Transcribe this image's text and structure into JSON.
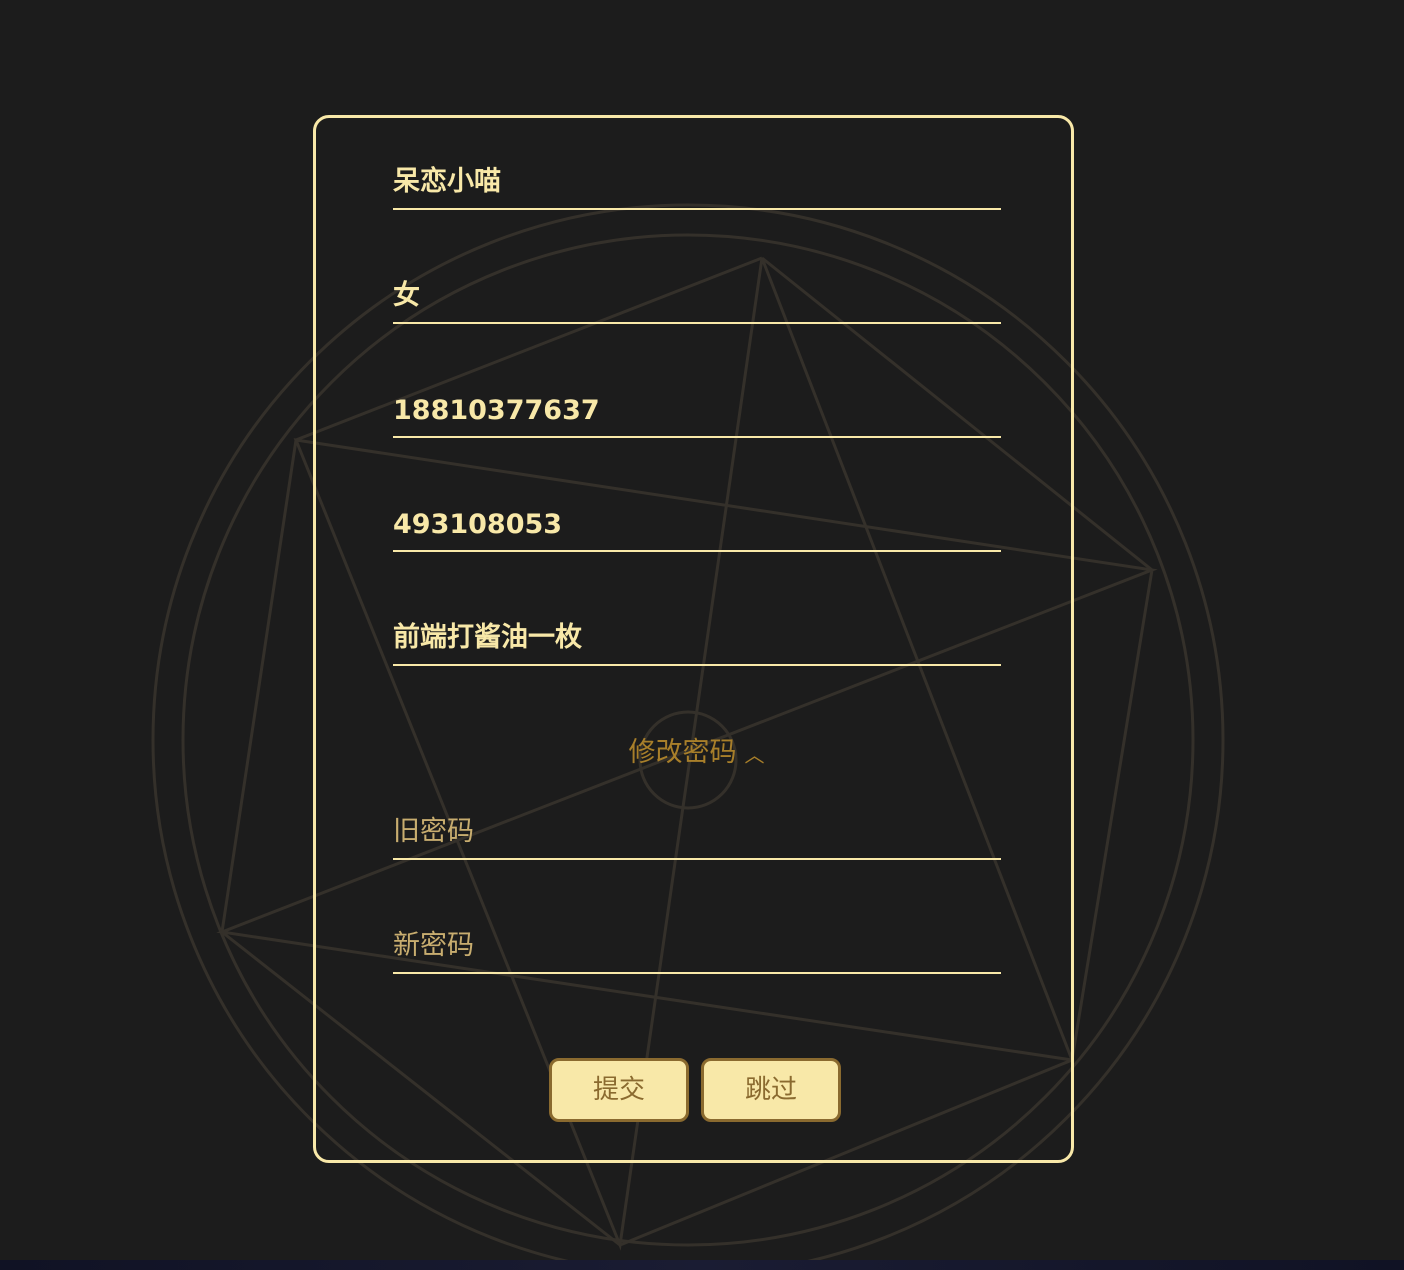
{
  "profile": {
    "nickname": "呆恋小喵",
    "gender": "女",
    "phone": "18810377637",
    "qq": "493108053",
    "signature": "前端打酱油一枚"
  },
  "password_section": {
    "toggle_label": "修改密码",
    "toggle_icon": "chevron-up-icon",
    "old_password_placeholder": "旧密码",
    "new_password_placeholder": "新密码"
  },
  "actions": {
    "submit_label": "提交",
    "skip_label": "跳过"
  },
  "colors": {
    "background": "#1c1c1c",
    "accent": "#f8e8a8",
    "muted_accent": "#a87f2a",
    "button_text": "#8a6a2f"
  }
}
